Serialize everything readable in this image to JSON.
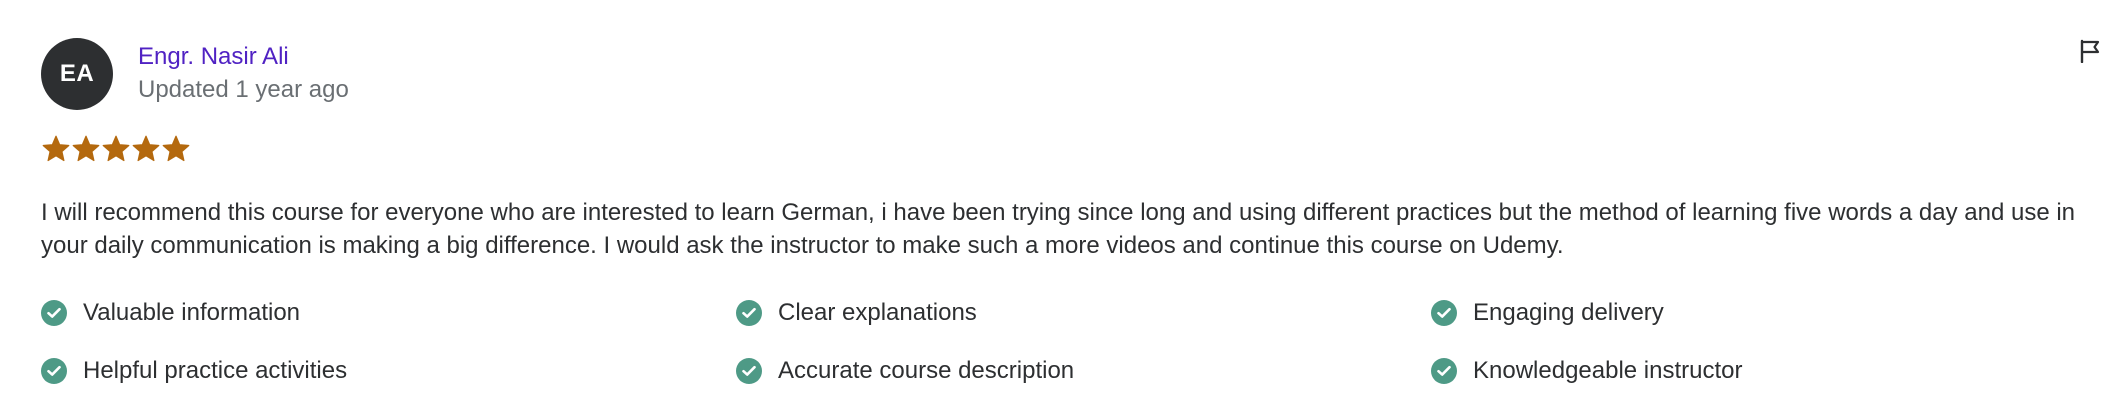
{
  "reviewer": {
    "initials": "EA",
    "name": "Engr. Nasir Ali",
    "updated": "Updated 1 year ago"
  },
  "rating": {
    "stars": 5,
    "max": 5,
    "star_color": "#b4690e"
  },
  "review": {
    "text": "I will recommend this course for everyone who are interested to learn German, i have been trying since long and using different practices but the method of learning five words a day and use in your daily communication is making a big difference. I would ask the instructor to make such a more videos and continue this course on Udemy."
  },
  "tags": [
    {
      "label": "Valuable information",
      "icon": "check-circle-icon"
    },
    {
      "label": "Clear explanations",
      "icon": "check-circle-icon"
    },
    {
      "label": "Engaging delivery",
      "icon": "check-circle-icon"
    },
    {
      "label": "Helpful practice activities",
      "icon": "check-circle-icon"
    },
    {
      "label": "Accurate course description",
      "icon": "check-circle-icon"
    },
    {
      "label": "Knowledgeable instructor",
      "icon": "check-circle-icon"
    }
  ],
  "actions": {
    "report_icon": "flag-icon"
  },
  "colors": {
    "name_link": "#5022c3",
    "avatar_bg": "#2d2f31",
    "check_green": "#4e9a86",
    "muted_text": "#6a6f73"
  }
}
